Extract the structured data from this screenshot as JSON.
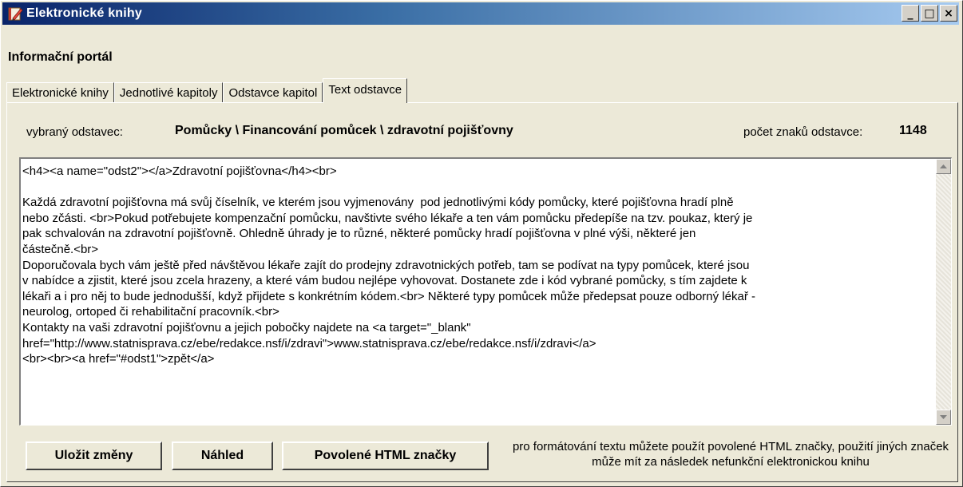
{
  "window": {
    "title": "Elektronické knihy",
    "app_icon": "pen-book-icon"
  },
  "header": {
    "title": "Informační portál"
  },
  "tabs": [
    {
      "label": "Elektronické knihy"
    },
    {
      "label": "Jednotlivé kapitoly"
    },
    {
      "label": "Odstavce kapitol"
    },
    {
      "label": "Text odstavce"
    }
  ],
  "active_tab": "Text odstavce",
  "selection": {
    "label": "vybraný odstavec:",
    "value": "Pomůcky \\ Financování pomůcek \\ zdravotní pojišťovny",
    "count_label": "počet znaků odstavce:",
    "count_value": "1148"
  },
  "editor": {
    "text": "<h4><a name=\"odst2\"></a>Zdravotní pojišťovna</h4><br>\n\nKaždá zdravotní pojišťovna má svůj číselník, ve kterém jsou vyjmenovány  pod jednotlivými kódy pomůcky, které pojišťovna hradí plně\nnebo zčásti. <br>Pokud potřebujete kompenzační pomůcku, navštivte svého lékaře a ten vám pomůcku předepíše na tzv. poukaz, který je\npak schvalován na zdravotní pojišťovně. Ohledně úhrady je to různé, některé pomůcky hradí pojišťovna v plné výši, některé jen\nčástečně.<br>\nDoporučovala bych vám ještě před návštěvou lékaře zajít do prodejny zdravotnických potřeb, tam se podívat na typy pomůcek, které jsou\nv nabídce a zjistit, které jsou zcela hrazeny, a které vám budou nejlépe vyhovovat. Dostanete zde i kód vybrané pomůcky, s tím zajdete k\nlékaři a i pro něj to bude jednodušší, když přijdete s konkrétním kódem.<br> Některé typy pomůcek může předepsat pouze odborný lékař -\nneurolog, ortoped či rehabilitační pracovník.<br>\nKontakty na vaši zdravotní pojišťovnu a jejich pobočky najdete na <a target=\"_blank\"\nhref=\"http://www.statnisprava.cz/ebe/redakce.nsf/i/zdravi\">www.statnisprava.cz/ebe/redakce.nsf/i/zdravi</a>\n<br><br><a href=\"#odst1\">zpět</a>"
  },
  "buttons": {
    "save": "Uložit změny",
    "preview": "Náhled",
    "allowed_tags": "Povolené HTML značky"
  },
  "hint": "pro formátování textu můžete použít povolené HTML značky, použití jiných značek může mít za následek nefunkční elektronickou knihu",
  "window_buttons": {
    "minimize": "_",
    "maximize": "□",
    "close": "×"
  }
}
